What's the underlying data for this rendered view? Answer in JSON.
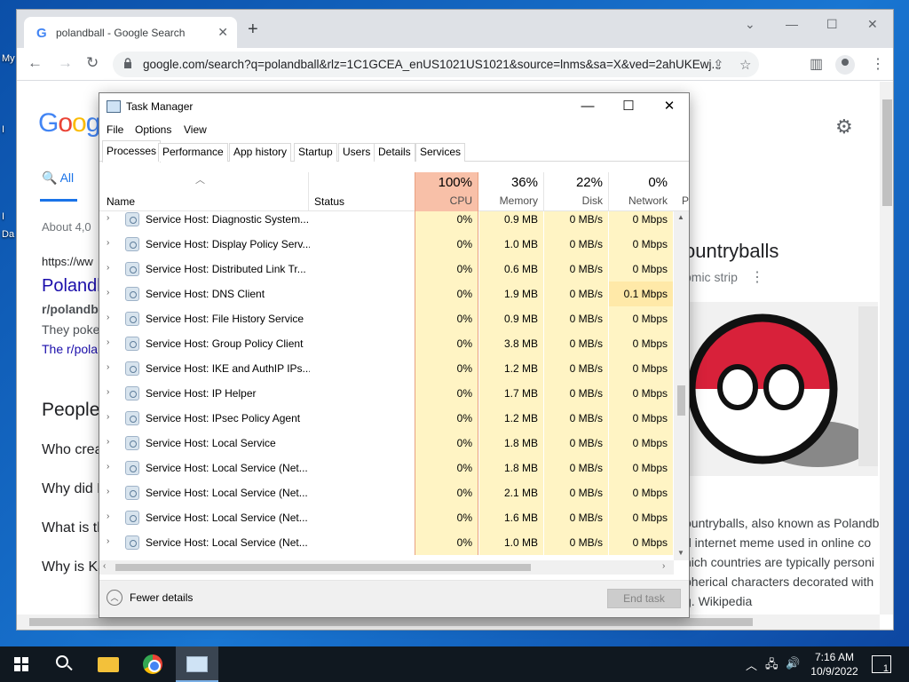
{
  "desktop": {
    "icons": [
      {
        "label": "My"
      },
      {
        "label": "I"
      },
      {
        "label": "I"
      },
      {
        "label": "Da"
      }
    ]
  },
  "chrome": {
    "tab_title": "polandball - Google Search",
    "url": "google.com/search?q=polandball&rlz=1C1GCEA_enUS1021US1021&source=lnms&sa=X&ved=2ahUKEwj...",
    "page": {
      "logo_letters": [
        "G",
        "o",
        "o",
        "g"
      ],
      "tab_all": "All",
      "results_count": "About 4,0",
      "result_url": "https://ww",
      "result_title": "Polandl",
      "result_sub": "r/polandba",
      "result_snip": "They poke",
      "result_snip2": "The r/pola",
      "people_heading": "People",
      "paa": [
        "Who crea",
        "Why did P",
        "What is th",
        "Why is Ka"
      ],
      "kp_title": "ountryballs",
      "kp_sub": "omic strip",
      "kp_lines": [
        "ountryballs, also known as Polandb",
        "d internet meme used in online co",
        "hich countries are typically personi",
        "pherical characters decorated with",
        "g. Wikipedia"
      ]
    }
  },
  "task_manager": {
    "title": "Task Manager",
    "menu": [
      "File",
      "Options",
      "View"
    ],
    "tabs": [
      "Processes",
      "Performance",
      "App history",
      "Startup",
      "Users",
      "Details",
      "Services"
    ],
    "columns": {
      "name": "Name",
      "status": "Status",
      "cpu_pct": "100%",
      "cpu": "CPU",
      "mem_pct": "36%",
      "mem": "Memory",
      "disk_pct": "22%",
      "disk": "Disk",
      "net_pct": "0%",
      "net": "Network",
      "power": "P"
    },
    "rows": [
      {
        "name": "Service Host: Diagnostic System...",
        "cpu": "0%",
        "mem": "0.9 MB",
        "disk": "0 MB/s",
        "net": "0 Mbps"
      },
      {
        "name": "Service Host: Display Policy Serv...",
        "cpu": "0%",
        "mem": "1.0 MB",
        "disk": "0 MB/s",
        "net": "0 Mbps"
      },
      {
        "name": "Service Host: Distributed Link Tr...",
        "cpu": "0%",
        "mem": "0.6 MB",
        "disk": "0 MB/s",
        "net": "0 Mbps"
      },
      {
        "name": "Service Host: DNS Client",
        "cpu": "0%",
        "mem": "1.9 MB",
        "disk": "0 MB/s",
        "net": "0.1 Mbps"
      },
      {
        "name": "Service Host: File History Service",
        "cpu": "0%",
        "mem": "0.9 MB",
        "disk": "0 MB/s",
        "net": "0 Mbps"
      },
      {
        "name": "Service Host: Group Policy Client",
        "cpu": "0%",
        "mem": "3.8 MB",
        "disk": "0 MB/s",
        "net": "0 Mbps"
      },
      {
        "name": "Service Host: IKE and AuthIP IPs...",
        "cpu": "0%",
        "mem": "1.2 MB",
        "disk": "0 MB/s",
        "net": "0 Mbps"
      },
      {
        "name": "Service Host: IP Helper",
        "cpu": "0%",
        "mem": "1.7 MB",
        "disk": "0 MB/s",
        "net": "0 Mbps"
      },
      {
        "name": "Service Host: IPsec Policy Agent",
        "cpu": "0%",
        "mem": "1.2 MB",
        "disk": "0 MB/s",
        "net": "0 Mbps"
      },
      {
        "name": "Service Host: Local Service",
        "cpu": "0%",
        "mem": "1.8 MB",
        "disk": "0 MB/s",
        "net": "0 Mbps"
      },
      {
        "name": "Service Host: Local Service (Net...",
        "cpu": "0%",
        "mem": "1.8 MB",
        "disk": "0 MB/s",
        "net": "0 Mbps"
      },
      {
        "name": "Service Host: Local Service (Net...",
        "cpu": "0%",
        "mem": "2.1 MB",
        "disk": "0 MB/s",
        "net": "0 Mbps"
      },
      {
        "name": "Service Host: Local Service (Net...",
        "cpu": "0%",
        "mem": "1.6 MB",
        "disk": "0 MB/s",
        "net": "0 Mbps"
      },
      {
        "name": "Service Host: Local Service (Net...",
        "cpu": "0%",
        "mem": "1.0 MB",
        "disk": "0 MB/s",
        "net": "0 Mbps"
      }
    ],
    "fewer_details": "Fewer details",
    "end_task": "End task"
  },
  "taskbar": {
    "time": "7:16 AM",
    "date": "10/9/2022",
    "notifications": "1"
  }
}
